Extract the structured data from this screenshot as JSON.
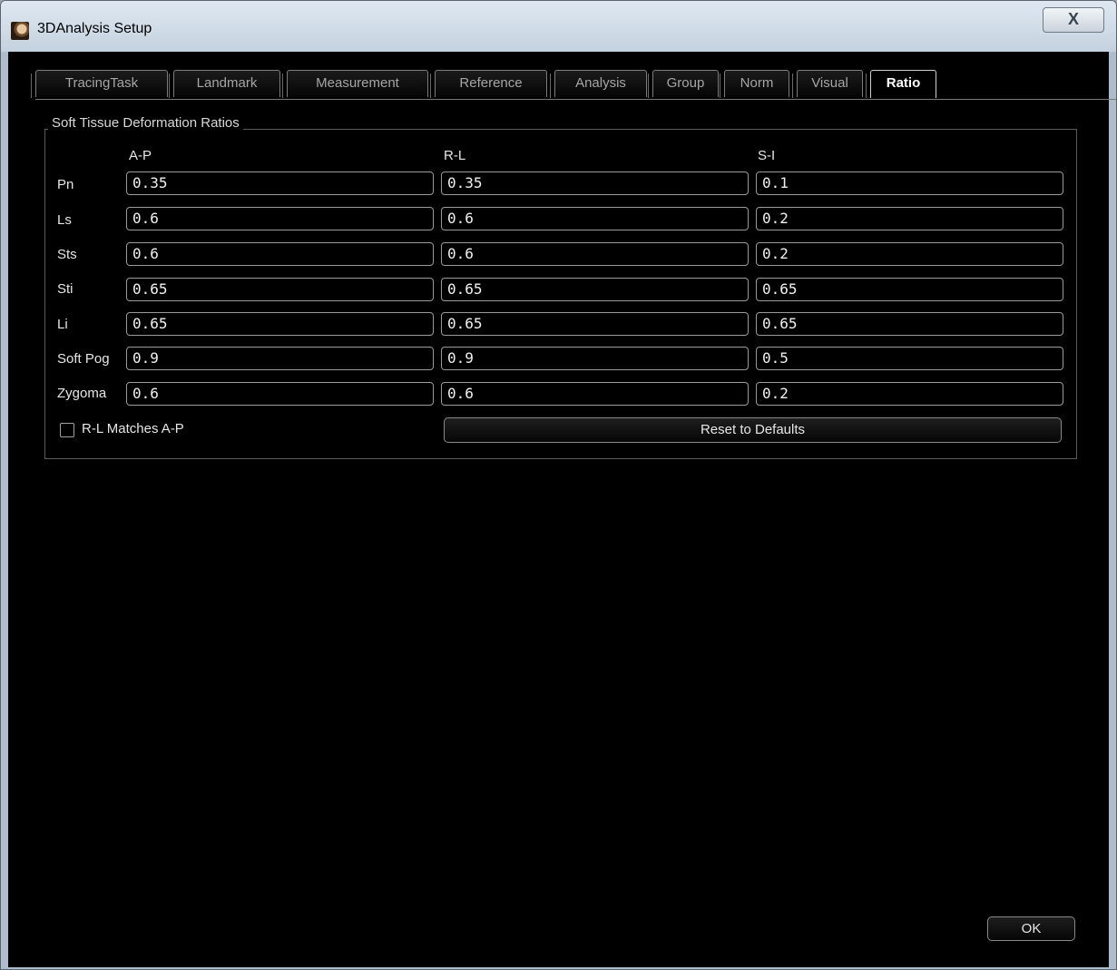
{
  "window": {
    "title": "3DAnalysis Setup",
    "close_glyph": "X",
    "icon": "app-icon"
  },
  "tabs": [
    {
      "label": "TracingTask",
      "active": false
    },
    {
      "label": "Landmark",
      "active": false
    },
    {
      "label": "Measurement",
      "active": false
    },
    {
      "label": "Reference",
      "active": false
    },
    {
      "label": "Analysis",
      "active": false
    },
    {
      "label": "Group",
      "active": false
    },
    {
      "label": "Norm",
      "active": false
    },
    {
      "label": "Visual",
      "active": false
    },
    {
      "label": "Ratio",
      "active": true
    }
  ],
  "group": {
    "title": "Soft Tissue Deformation Ratios",
    "columns": [
      "A-P",
      "R-L",
      "S-I"
    ],
    "rows": [
      {
        "label": "Pn",
        "values": [
          "0.35",
          "0.35",
          "0.1"
        ]
      },
      {
        "label": "Ls",
        "values": [
          "0.6",
          "0.6",
          "0.2"
        ]
      },
      {
        "label": "Sts",
        "values": [
          "0.6",
          "0.6",
          "0.2"
        ]
      },
      {
        "label": "Sti",
        "values": [
          "0.65",
          "0.65",
          "0.65"
        ]
      },
      {
        "label": "Li",
        "values": [
          "0.65",
          "0.65",
          "0.65"
        ]
      },
      {
        "label": "Soft Pog",
        "values": [
          "0.9",
          "0.9",
          "0.5"
        ]
      },
      {
        "label": "Zygoma",
        "values": [
          "0.6",
          "0.6",
          "0.2"
        ]
      }
    ],
    "checkbox": {
      "label": "R-L Matches A-P",
      "checked": false
    },
    "reset_label": "Reset to Defaults"
  },
  "ok_label": "OK"
}
